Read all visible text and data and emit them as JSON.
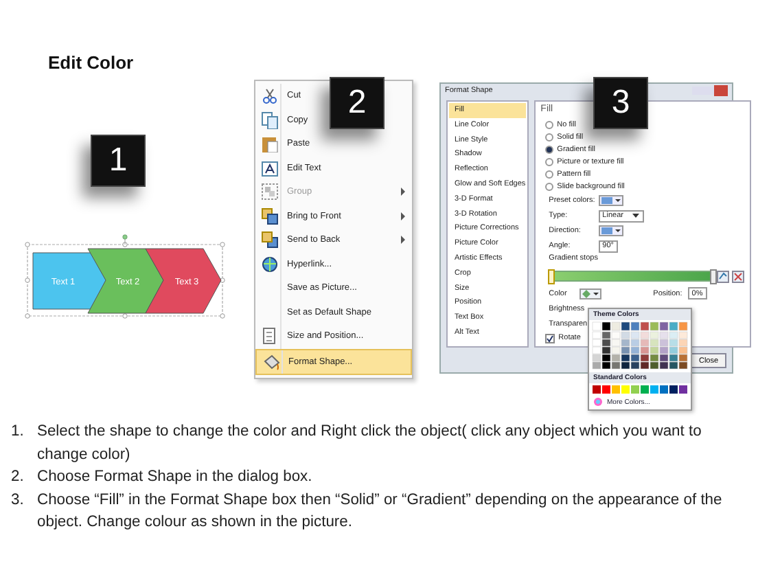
{
  "title": "Edit Color",
  "steps": [
    {
      "number": "1"
    },
    {
      "number": "2"
    },
    {
      "number": "3"
    }
  ],
  "shape": {
    "segments": [
      {
        "label": "Text 1",
        "color": "#4cc4ee"
      },
      {
        "label": "Text 2",
        "color": "#6abf5c"
      },
      {
        "label": "Text 3",
        "color": "#e04a5e"
      }
    ]
  },
  "context_menu": {
    "items": [
      {
        "label": "Cut",
        "disabled": false,
        "submenu": false,
        "selected": false
      },
      {
        "label": "Copy",
        "disabled": false,
        "submenu": false,
        "selected": false
      },
      {
        "label": "Paste",
        "disabled": false,
        "submenu": false,
        "selected": false
      },
      {
        "label": "Edit Text",
        "disabled": false,
        "submenu": false,
        "selected": false
      },
      {
        "label": "Group",
        "disabled": true,
        "submenu": true,
        "selected": false
      },
      {
        "label": "Bring to Front",
        "disabled": false,
        "submenu": true,
        "selected": false
      },
      {
        "label": "Send to Back",
        "disabled": false,
        "submenu": true,
        "selected": false
      },
      {
        "label": "Hyperlink...",
        "disabled": false,
        "submenu": false,
        "selected": false
      },
      {
        "label": "Save as Picture...",
        "disabled": false,
        "submenu": false,
        "selected": false
      },
      {
        "label": "Set as Default Shape",
        "disabled": false,
        "submenu": false,
        "selected": false
      },
      {
        "label": "Size and Position...",
        "disabled": false,
        "submenu": false,
        "selected": false
      },
      {
        "label": "Format Shape...",
        "disabled": false,
        "submenu": false,
        "selected": true
      }
    ]
  },
  "format_dialog": {
    "title": "Format Shape",
    "categories": [
      {
        "label": "Fill",
        "selected": true
      },
      {
        "label": "Line Color",
        "selected": false
      },
      {
        "label": "Line Style",
        "selected": false
      },
      {
        "label": "Shadow",
        "selected": false
      },
      {
        "label": "Reflection",
        "selected": false
      },
      {
        "label": "Glow and Soft Edges",
        "selected": false
      },
      {
        "label": "3-D Format",
        "selected": false
      },
      {
        "label": "3-D Rotation",
        "selected": false
      },
      {
        "label": "Picture Corrections",
        "selected": false
      },
      {
        "label": "Picture Color",
        "selected": false
      },
      {
        "label": "Artistic Effects",
        "selected": false
      },
      {
        "label": "Crop",
        "selected": false
      },
      {
        "label": "Size",
        "selected": false
      },
      {
        "label": "Position",
        "selected": false
      },
      {
        "label": "Text Box",
        "selected": false
      },
      {
        "label": "Alt Text",
        "selected": false
      }
    ],
    "section_title": "Fill",
    "fill_options": [
      {
        "label": "No fill",
        "selected": false
      },
      {
        "label": "Solid fill",
        "selected": false
      },
      {
        "label": "Gradient fill",
        "selected": true
      },
      {
        "label": "Picture or texture fill",
        "selected": false
      },
      {
        "label": "Pattern fill",
        "selected": false
      },
      {
        "label": "Slide background fill",
        "selected": false
      }
    ],
    "fields": [
      {
        "label": "Preset colors:",
        "kind": "swatch"
      },
      {
        "label": "Type:",
        "kind": "select",
        "value": "Linear"
      },
      {
        "label": "Direction:",
        "kind": "swatch"
      },
      {
        "label": "Angle:",
        "kind": "spin",
        "value": "90°"
      }
    ],
    "stops_label": "Gradient stops",
    "gradient_stops": [
      {
        "level": 0,
        "selected": true
      },
      {
        "level": 1,
        "selected": false
      }
    ],
    "color_label": "Color",
    "position_label": "Position:",
    "position_value": "0%",
    "brightness_label": "Brightness",
    "transparency_label": "Transparen",
    "rotate": {
      "label": "Rotate",
      "checked": true
    },
    "close_button": "Close"
  },
  "color_popup": {
    "theme_title": "Theme Colors",
    "standard_title": "Standard Colors",
    "more_label": "More Colors..."
  },
  "instructions": [
    {
      "number": "1.",
      "text": "Select the shape to change the color and Right click the object( click any object which you want to change color)"
    },
    {
      "number": "2.",
      "text": "Choose Format Shape in the dialog box."
    },
    {
      "number": "3.",
      "text": "Choose “Fill” in the Format Shape box then “Solid” or “Gradient” depending on the appearance of the object. Change colour as shown in the picture."
    }
  ]
}
